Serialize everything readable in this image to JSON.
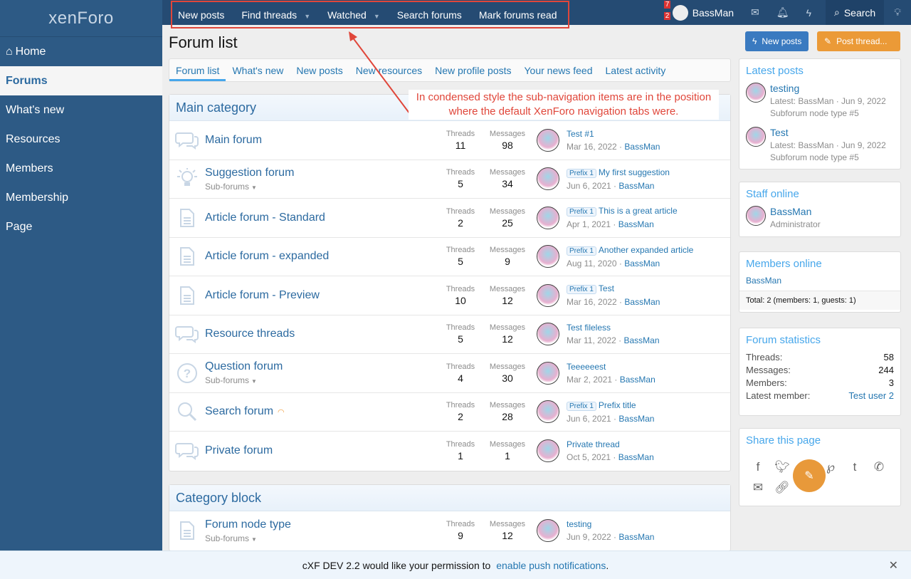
{
  "logo": "xenForo",
  "sidebar": {
    "items": [
      {
        "label": "Home"
      },
      {
        "label": "Forums"
      },
      {
        "label": "What's new"
      },
      {
        "label": "Resources"
      },
      {
        "label": "Members"
      },
      {
        "label": "Membership"
      },
      {
        "label": "Page"
      }
    ]
  },
  "subnav": [
    "New posts",
    "Find threads",
    "Watched",
    "Search forums",
    "Mark forums read"
  ],
  "user": {
    "name": "BassMan",
    "badge_top": "7",
    "badge_bottom": "2",
    "search": "Search"
  },
  "page": {
    "title": "Forum list",
    "new_posts": "New posts",
    "post_thread": "Post thread..."
  },
  "tabs": [
    "Forum list",
    "What's new",
    "New posts",
    "New resources",
    "New profile posts",
    "Your news feed",
    "Latest activity"
  ],
  "callout": "In condensed style the sub-navigation items are in the position where the default XenForo navigation tabs were.",
  "labels": {
    "threads": "Threads",
    "messages": "Messages",
    "subforums": "Sub-forums"
  },
  "categories": [
    {
      "title": "Main category",
      "forums": [
        {
          "icon": "chat",
          "title": "Main forum",
          "threads": "11",
          "messages": "98",
          "latest": "Test #1",
          "date": "Mar 16, 2022",
          "user": "BassMan"
        },
        {
          "icon": "bulb",
          "title": "Suggestion forum",
          "sub": true,
          "threads": "5",
          "messages": "34",
          "prefix": "Prefix 1",
          "latest": "My first suggestion",
          "date": "Jun 6, 2021",
          "user": "BassMan"
        },
        {
          "icon": "doc",
          "title": "Article forum - Standard",
          "threads": "2",
          "messages": "25",
          "prefix": "Prefix 1",
          "latest": "This is a great article",
          "date": "Apr 1, 2021",
          "user": "BassMan"
        },
        {
          "icon": "doc",
          "title": "Article forum - expanded",
          "threads": "5",
          "messages": "9",
          "prefix": "Prefix 1",
          "latest": "Another expanded article",
          "date": "Aug 11, 2020",
          "user": "BassMan"
        },
        {
          "icon": "doc",
          "title": "Article forum - Preview",
          "threads": "10",
          "messages": "12",
          "prefix": "Prefix 1",
          "latest": "Test",
          "date": "Mar 16, 2022",
          "user": "BassMan"
        },
        {
          "icon": "chat",
          "title": "Resource threads",
          "threads": "5",
          "messages": "12",
          "latest": "Test fileless",
          "date": "Mar 11, 2022",
          "user": "BassMan"
        },
        {
          "icon": "question",
          "title": "Question forum",
          "sub": true,
          "threads": "4",
          "messages": "30",
          "latest": "Teeeeeest",
          "date": "Mar 2, 2021",
          "user": "BassMan"
        },
        {
          "icon": "search",
          "title": "Search forum",
          "rss": true,
          "threads": "2",
          "messages": "28",
          "prefix": "Prefix 1",
          "latest": "Prefix title",
          "date": "Jun 6, 2021",
          "user": "BassMan"
        },
        {
          "icon": "chat",
          "title": "Private forum",
          "threads": "1",
          "messages": "1",
          "latest": "Private thread",
          "date": "Oct 5, 2021",
          "user": "BassMan"
        }
      ]
    },
    {
      "title": "Category block",
      "forums": [
        {
          "icon": "doc",
          "title": "Forum node type",
          "sub": true,
          "threads": "9",
          "messages": "12",
          "latest": "testing",
          "date": "Jun 9, 2022",
          "user": "BassMan"
        }
      ]
    }
  ],
  "widgets": {
    "latest_posts": {
      "title": "Latest posts",
      "items": [
        {
          "title": "testing",
          "meta": "Latest: BassMan · Jun 9, 2022",
          "node": "Subforum node type #5"
        },
        {
          "title": "Test",
          "meta": "Latest: BassMan · Jun 9, 2022",
          "node": "Subforum node type #5"
        }
      ]
    },
    "staff_online": {
      "title": "Staff online",
      "name": "BassMan",
      "role": "Administrator"
    },
    "members_online": {
      "title": "Members online",
      "name": "BassMan",
      "total": "Total: 2 (members: 1, guests: 1)"
    },
    "stats": {
      "title": "Forum statistics",
      "rows": [
        {
          "k": "Threads:",
          "v": "58"
        },
        {
          "k": "Messages:",
          "v": "244"
        },
        {
          "k": "Members:",
          "v": "3"
        },
        {
          "k": "Latest member:",
          "v": "Test user 2"
        }
      ]
    },
    "share": {
      "title": "Share this page"
    }
  },
  "notice": {
    "text": "cXF DEV 2.2 would like your permission to ",
    "link": "enable push notifications",
    "end": "."
  }
}
